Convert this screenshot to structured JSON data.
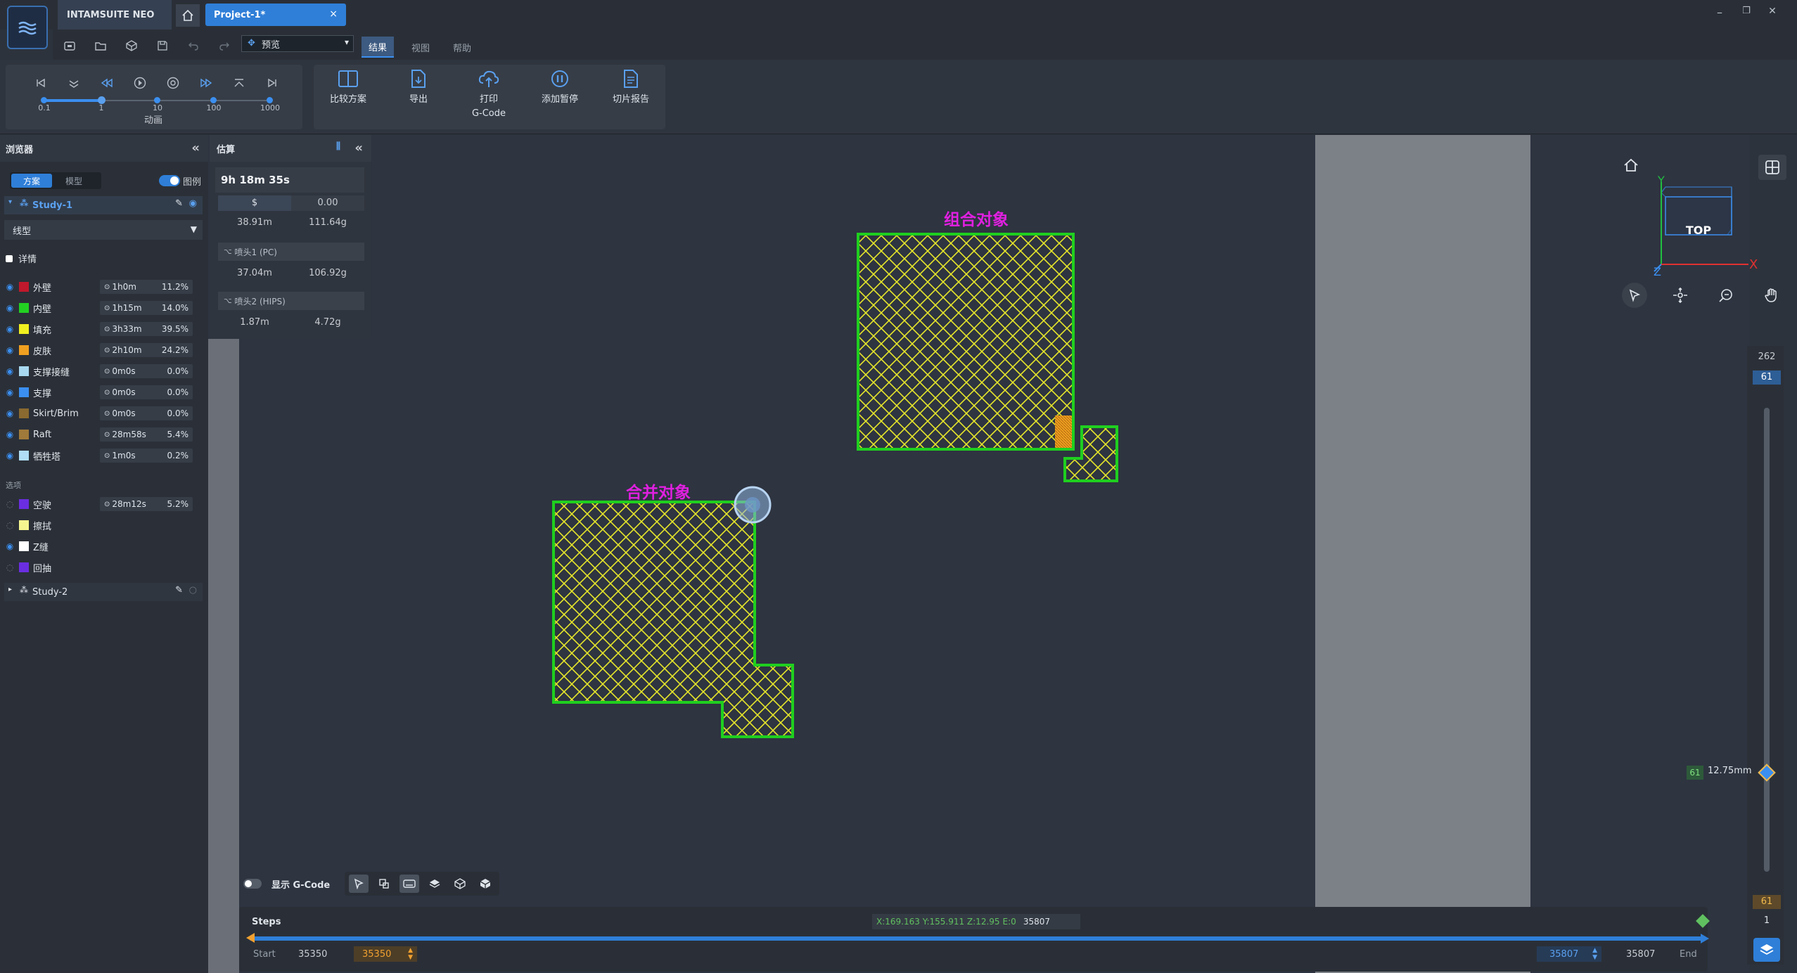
{
  "app": {
    "name": "INTAMSUITE NEO",
    "project_tab": "Project-1*",
    "close_glyph": "×"
  },
  "window": {
    "minimize": "–",
    "restore": "❐",
    "close": "✕"
  },
  "toolbar": {
    "view_mode": "预览"
  },
  "menu": {
    "tabs": [
      "结果",
      "视图",
      "帮助"
    ],
    "active": "结果"
  },
  "ribbon": {
    "animation_label": "动画",
    "speed_ticks": [
      "0.1",
      "1",
      "10",
      "100",
      "1000"
    ],
    "speed_value": "1",
    "buttons": [
      {
        "label": "比较方案",
        "icon": "compare-icon"
      },
      {
        "label": "导出",
        "icon": "export-icon"
      },
      {
        "label": "打印\nG-Code",
        "icon": "print-cloud-icon"
      },
      {
        "label": "添加暂停",
        "icon": "pause-icon"
      },
      {
        "label": "切片报告",
        "icon": "report-icon"
      }
    ]
  },
  "browser": {
    "title": "浏览器",
    "seg_tabs": [
      "方案",
      "模型"
    ],
    "legend_label": "图例",
    "legend_on": true,
    "study1": "Study-1",
    "line_type": "线型",
    "detail_label": "详情",
    "features": [
      {
        "name": "外壁",
        "color": "#c0182c",
        "time": "1h0m",
        "pct": "11.2%",
        "visible": true
      },
      {
        "name": "内壁",
        "color": "#22d022",
        "time": "1h15m",
        "pct": "14.0%",
        "visible": true
      },
      {
        "name": "填充",
        "color": "#f0f020",
        "time": "3h33m",
        "pct": "39.5%",
        "visible": true
      },
      {
        "name": "皮肤",
        "color": "#f0a020",
        "time": "2h10m",
        "pct": "24.2%",
        "visible": true
      },
      {
        "name": "支撑接缝",
        "color": "#a8d8f0",
        "time": "0m0s",
        "pct": "0.0%",
        "visible": true
      },
      {
        "name": "支撑",
        "color": "#3b8ff0",
        "time": "0m0s",
        "pct": "0.0%",
        "visible": true
      },
      {
        "name": "Skirt/Brim",
        "color": "#8a6a30",
        "time": "0m0s",
        "pct": "0.0%",
        "visible": true
      },
      {
        "name": "Raft",
        "color": "#a07a3a",
        "time": "28m58s",
        "pct": "5.4%",
        "visible": true
      },
      {
        "name": "牺牲塔",
        "color": "#b0dcf5",
        "time": "1m0s",
        "pct": "0.2%",
        "visible": true
      }
    ],
    "options_label": "选项",
    "options": [
      {
        "name": "空驶",
        "color": "#6a2ee0",
        "time": "28m12s",
        "pct": "5.2%",
        "visible": false
      },
      {
        "name": "擦拭",
        "color": "#f5f590",
        "visible": false
      },
      {
        "name": "Z缝",
        "color": "#ffffff",
        "visible": true
      },
      {
        "name": "回抽",
        "color": "#6a2ee0",
        "visible": false
      }
    ],
    "study2": "Study-2"
  },
  "estimate": {
    "title": "估算",
    "total_time": "9h 18m 35s",
    "cost_symbol": "$",
    "cost": "0.00",
    "total_length": "38.91m",
    "total_weight": "111.64g",
    "heads": [
      {
        "name": "喷头1 (PC)",
        "length": "37.04m",
        "weight": "106.92g"
      },
      {
        "name": "喷头2 (HIPS)",
        "length": "1.87m",
        "weight": "4.72g"
      }
    ]
  },
  "viewport": {
    "label_group": "组合对象",
    "label_merge": "合并对象",
    "cube_face": "TOP",
    "axis_x": "X",
    "axis_y": "Y",
    "axis_z": "Z"
  },
  "layers": {
    "max": "262",
    "current": "61",
    "height": "12.75mm",
    "bottom_current": "61",
    "min": "1"
  },
  "bottom": {
    "show_gcode_label": "显示 G-Code",
    "show_gcode_on": false
  },
  "steps": {
    "label": "Steps",
    "coords": "X:169.163 Y:155.911 Z:12.95",
    "extrude": "E:0",
    "coord_step": "35807",
    "start_label": "Start",
    "start_value": "35350",
    "start_input": "35350",
    "end_input": "35807",
    "end_value": "35807",
    "end_label": "End"
  }
}
